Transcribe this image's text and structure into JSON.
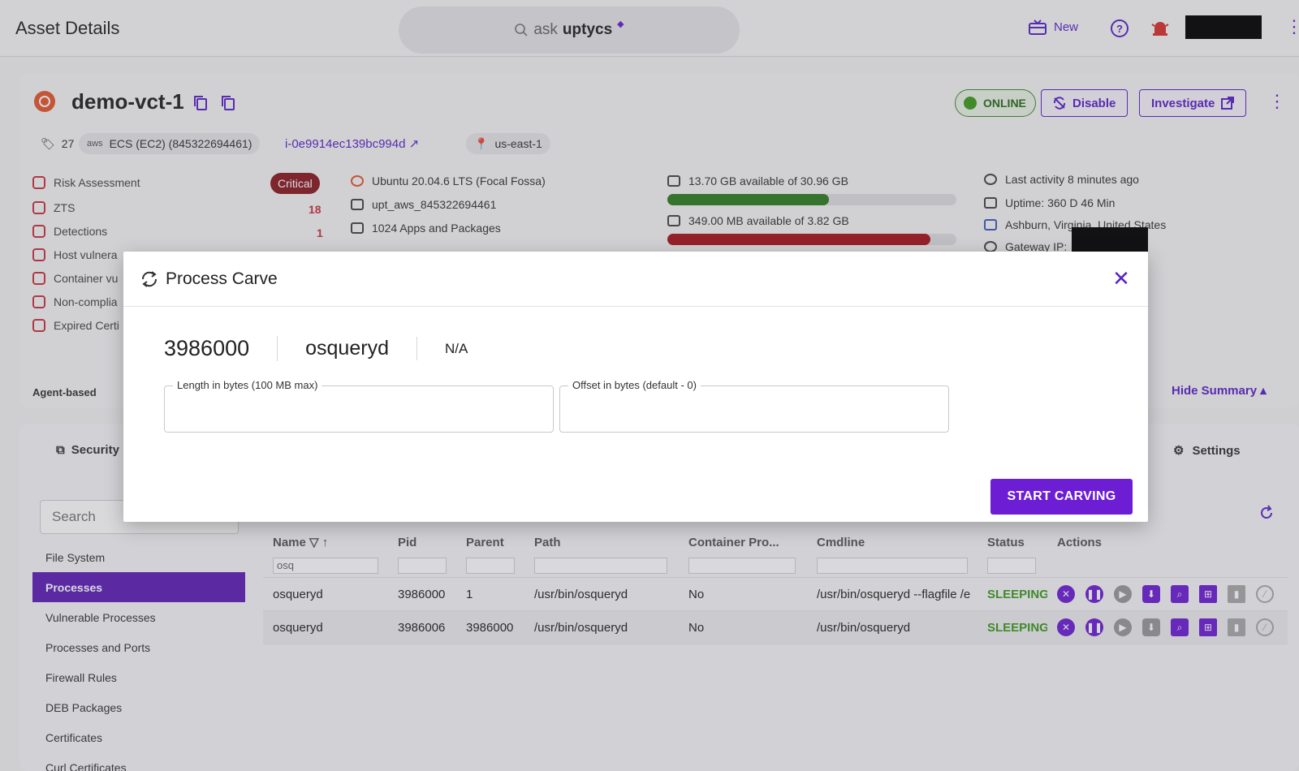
{
  "header": {
    "title": "Asset Details",
    "ask_prefix": "ask",
    "ask_brand": "uptycs",
    "new_label": "New"
  },
  "asset": {
    "name": "demo-vct-1",
    "status": "ONLINE",
    "disable_label": "Disable",
    "investigate_label": "Investigate",
    "tag_count": "27",
    "cloud_prefix": "aws",
    "cloud_label": "ECS (EC2) (845322694461)",
    "instance_id": "i-0e9914ec139bc994d",
    "region": "us-east-1"
  },
  "risk": {
    "items": [
      {
        "label": "Risk Assessment",
        "value": "Critical"
      },
      {
        "label": "ZTS",
        "value": "18"
      },
      {
        "label": "Detections",
        "value": "1"
      },
      {
        "label": "Host vulnera",
        "value": ""
      },
      {
        "label": "Container vu",
        "value": ""
      },
      {
        "label": "Non-complia",
        "value": ""
      },
      {
        "label": "Expired Certi",
        "value": ""
      }
    ]
  },
  "system": {
    "os": "Ubuntu 20.04.6 LTS (Focal Fossa)",
    "account": "upt_aws_845322694461",
    "apps": "1024 Apps and Packages",
    "disk": "13.70 GB available of 30.96 GB",
    "disk_used_fraction": 0.56,
    "memory": "349.00 MB available of 3.82 GB",
    "memory_used_fraction": 0.91,
    "last_activity": "Last activity 8 minutes ago",
    "uptime": "Uptime: 360 D 46 Min",
    "location": "Ashburn, Virginia, United States",
    "gateway": "Gateway IP:"
  },
  "summary": {
    "agent": "Agent-based",
    "hide": "Hide Summary"
  },
  "tabs": {
    "security": "Security",
    "settings": "Settings"
  },
  "sidebar": {
    "search_placeholder": "Search",
    "items": [
      {
        "label": "File System"
      },
      {
        "label": "Processes"
      },
      {
        "label": "Vulnerable Processes"
      },
      {
        "label": "Processes and Ports"
      },
      {
        "label": "Firewall Rules"
      },
      {
        "label": "DEB Packages"
      },
      {
        "label": "Certificates"
      },
      {
        "label": "Curl Certificates"
      }
    ]
  },
  "table": {
    "columns": [
      "Name",
      "Pid",
      "Parent",
      "Path",
      "Container Pro...",
      "Cmdline",
      "Status",
      "Actions"
    ],
    "filter_name": "osq",
    "rows": [
      {
        "name": "osqueryd",
        "pid": "3986000",
        "parent": "1",
        "path": "/usr/bin/osqueryd",
        "container": "No",
        "cmdline": "/usr/bin/osqueryd --flagfile /e",
        "status": "SLEEPING"
      },
      {
        "name": "osqueryd",
        "pid": "3986006",
        "parent": "3986000",
        "path": "/usr/bin/osqueryd",
        "container": "No",
        "cmdline": "/usr/bin/osqueryd",
        "status": "SLEEPING"
      }
    ]
  },
  "modal": {
    "title": "Process Carve",
    "pid": "3986000",
    "name": "osqueryd",
    "path": "N/A",
    "length_label": "Length in bytes (100 MB max)",
    "length_value": "",
    "offset_label": "Offset in bytes (default - 0)",
    "offset_value": "",
    "start_label": "START CARVING"
  },
  "colors": {
    "accent": "#6d1ed4",
    "critical": "#8a1a22",
    "disk_fill": "#2f7d1f",
    "memory_fill": "#a8141c",
    "sleeping": "#3a9a1e"
  }
}
